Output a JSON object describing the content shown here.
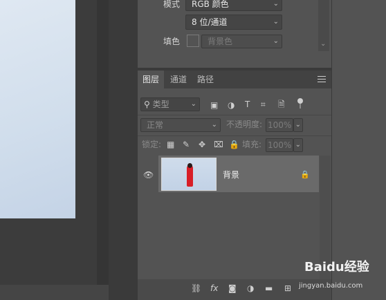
{
  "properties": {
    "mode_label": "模式",
    "mode_value": "RGB 颜色",
    "depth_value": "8 位/通道",
    "fill_label": "填色",
    "fill_value": "背景色"
  },
  "layers_panel": {
    "tabs": [
      {
        "label": "图层",
        "active": true
      },
      {
        "label": "通道",
        "active": false
      },
      {
        "label": "路径",
        "active": false
      }
    ],
    "filter_kind": "类型",
    "blend_mode": "正常",
    "opacity_label": "不透明度:",
    "opacity_value": "100%",
    "lock_label": "锁定:",
    "fill_label": "填充:",
    "fill_value": "100%",
    "layers": [
      {
        "name": "背景",
        "visible": true,
        "locked": true
      }
    ],
    "bottom_icons": [
      "link-icon",
      "fx-icon",
      "mask-icon",
      "adjustment-icon",
      "group-folder-icon",
      "new-layer-icon",
      "delete-icon"
    ]
  },
  "watermark": {
    "text": "Baidu经验",
    "sub": "jingyan.baidu.com"
  },
  "colors": {
    "panel_bg": "#535353",
    "selected_layer": "#6a6a6a",
    "canvas_bg": "#282828"
  }
}
